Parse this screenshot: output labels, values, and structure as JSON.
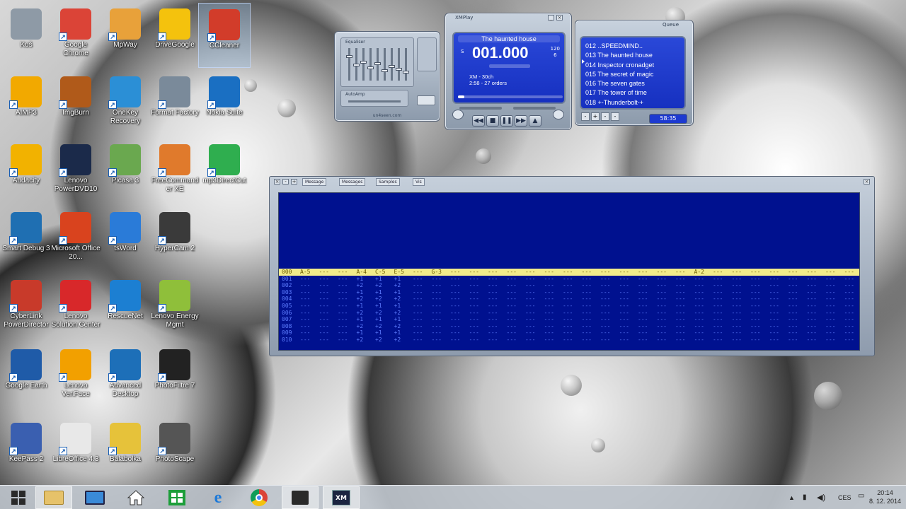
{
  "desktop_icons": [
    {
      "label": "Koš",
      "color": "#8e9aa6"
    },
    {
      "label": "Google Chrome",
      "color": "#db4437"
    },
    {
      "label": "MpWay",
      "color": "#e8a13a"
    },
    {
      "label": "DriveGoogle",
      "color": "#f4c20d"
    },
    {
      "label": "CCleaner",
      "color": "#d23c2a"
    },
    {
      "label": "AIMP3",
      "color": "#f2a900"
    },
    {
      "label": "ImgBurn",
      "color": "#b05a1a"
    },
    {
      "label": "OneKey Recovery",
      "color": "#2b8fd6"
    },
    {
      "label": "Format Factory",
      "color": "#7a8a9a"
    },
    {
      "label": "Nokia Suite",
      "color": "#1a6fc2"
    },
    {
      "label": "Audacity",
      "color": "#f2b200"
    },
    {
      "label": "Lenovo PowerDVD10",
      "color": "#1b2a4a"
    },
    {
      "label": "Picasa 3",
      "color": "#6aa84f"
    },
    {
      "label": "FreeCommander XE",
      "color": "#e07a2c"
    },
    {
      "label": "mp3DirectCut",
      "color": "#2fae4f"
    },
    {
      "label": "Smart Debug 3",
      "color": "#1f6fb2"
    },
    {
      "label": "Microsoft Office 20...",
      "color": "#d9431e"
    },
    {
      "label": "tsWord",
      "color": "#2a7bd8"
    },
    {
      "label": "HyperCam 2",
      "color": "#3a3a3a"
    },
    {
      "label": "CyberLink PowerDirector",
      "color": "#c83a2a"
    },
    {
      "label": "Lenovo Solution Center",
      "color": "#d8282a"
    },
    {
      "label": "RescueNet",
      "color": "#1c7fd2"
    },
    {
      "label": "Lenovo Energy Mgmt",
      "color": "#8fbf3a"
    },
    {
      "label": "Google Earth",
      "color": "#1f5ba8"
    },
    {
      "label": "Lenovo VeriFace",
      "color": "#f2a000"
    },
    {
      "label": "Advanced Desktop",
      "color": "#1d6fb8"
    },
    {
      "label": "PhotoFiltre 7",
      "color": "#222222"
    },
    {
      "label": "KeePass 2",
      "color": "#3a5fb0"
    },
    {
      "label": "LibreOffice 4.3",
      "color": "#e8e8e8"
    },
    {
      "label": "Balabolka",
      "color": "#e6c23a"
    },
    {
      "label": "PhotoScape",
      "color": "#555555"
    }
  ],
  "player": {
    "title": "XMPlay",
    "song_title": "The haunted house",
    "time": "001.000",
    "tempo": "120",
    "speed": "6",
    "format": "XM - 30ch",
    "position": "2:58 - 27 orders"
  },
  "equalizer": {
    "label": "Equaliser",
    "label2": "AutoAmp",
    "footer": "un4seen.com"
  },
  "playlist": {
    "label": "Queue",
    "items": [
      "012 ..SPEEDMIND..",
      "013 The haunted house",
      "014 Inspector cronadget",
      "015 The secret of magic",
      "016 The seven gates",
      "017 The tower of time",
      "018 +-Thunderbolt-+"
    ],
    "total_time": "58:35",
    "buttons": [
      "-",
      "+",
      "-",
      "-"
    ]
  },
  "pattern": {
    "tabs": [
      "Message",
      "Messages",
      "Samples",
      "Vis"
    ],
    "header_row": "000",
    "header_notes": [
      {
        "col": 0,
        "text": "A-5"
      },
      {
        "col": 3,
        "text": "A-4"
      },
      {
        "col": 4,
        "text": "C-5"
      },
      {
        "col": 5,
        "text": "E-5"
      },
      {
        "col": 7,
        "text": "G-3"
      },
      {
        "col": 21,
        "text": "A-2"
      }
    ],
    "rows": [
      {
        "num": "001",
        "v1": "+1",
        "v2": "+1",
        "v3": "+1"
      },
      {
        "num": "002",
        "v1": "+2",
        "v2": "+2",
        "v3": "+2"
      },
      {
        "num": "003",
        "v1": "+1",
        "v2": "+1",
        "v3": "+1"
      },
      {
        "num": "004",
        "v1": "+2",
        "v2": "+2",
        "v3": "+2"
      },
      {
        "num": "005",
        "v1": "+1",
        "v2": "+1",
        "v3": "+1"
      },
      {
        "num": "006",
        "v1": "+2",
        "v2": "+2",
        "v3": "+2"
      },
      {
        "num": "007",
        "v1": "+1",
        "v2": "+1",
        "v3": "+1"
      },
      {
        "num": "008",
        "v1": "+2",
        "v2": "+2",
        "v3": "+2"
      },
      {
        "num": "009",
        "v1": "+1",
        "v2": "+1",
        "v3": "+1"
      },
      {
        "num": "010",
        "v1": "+2",
        "v2": "+2",
        "v3": "+2"
      }
    ],
    "empty": "---"
  },
  "taskbar": {
    "language": "CES",
    "time": "20:14",
    "date": "8. 12. 2014"
  }
}
